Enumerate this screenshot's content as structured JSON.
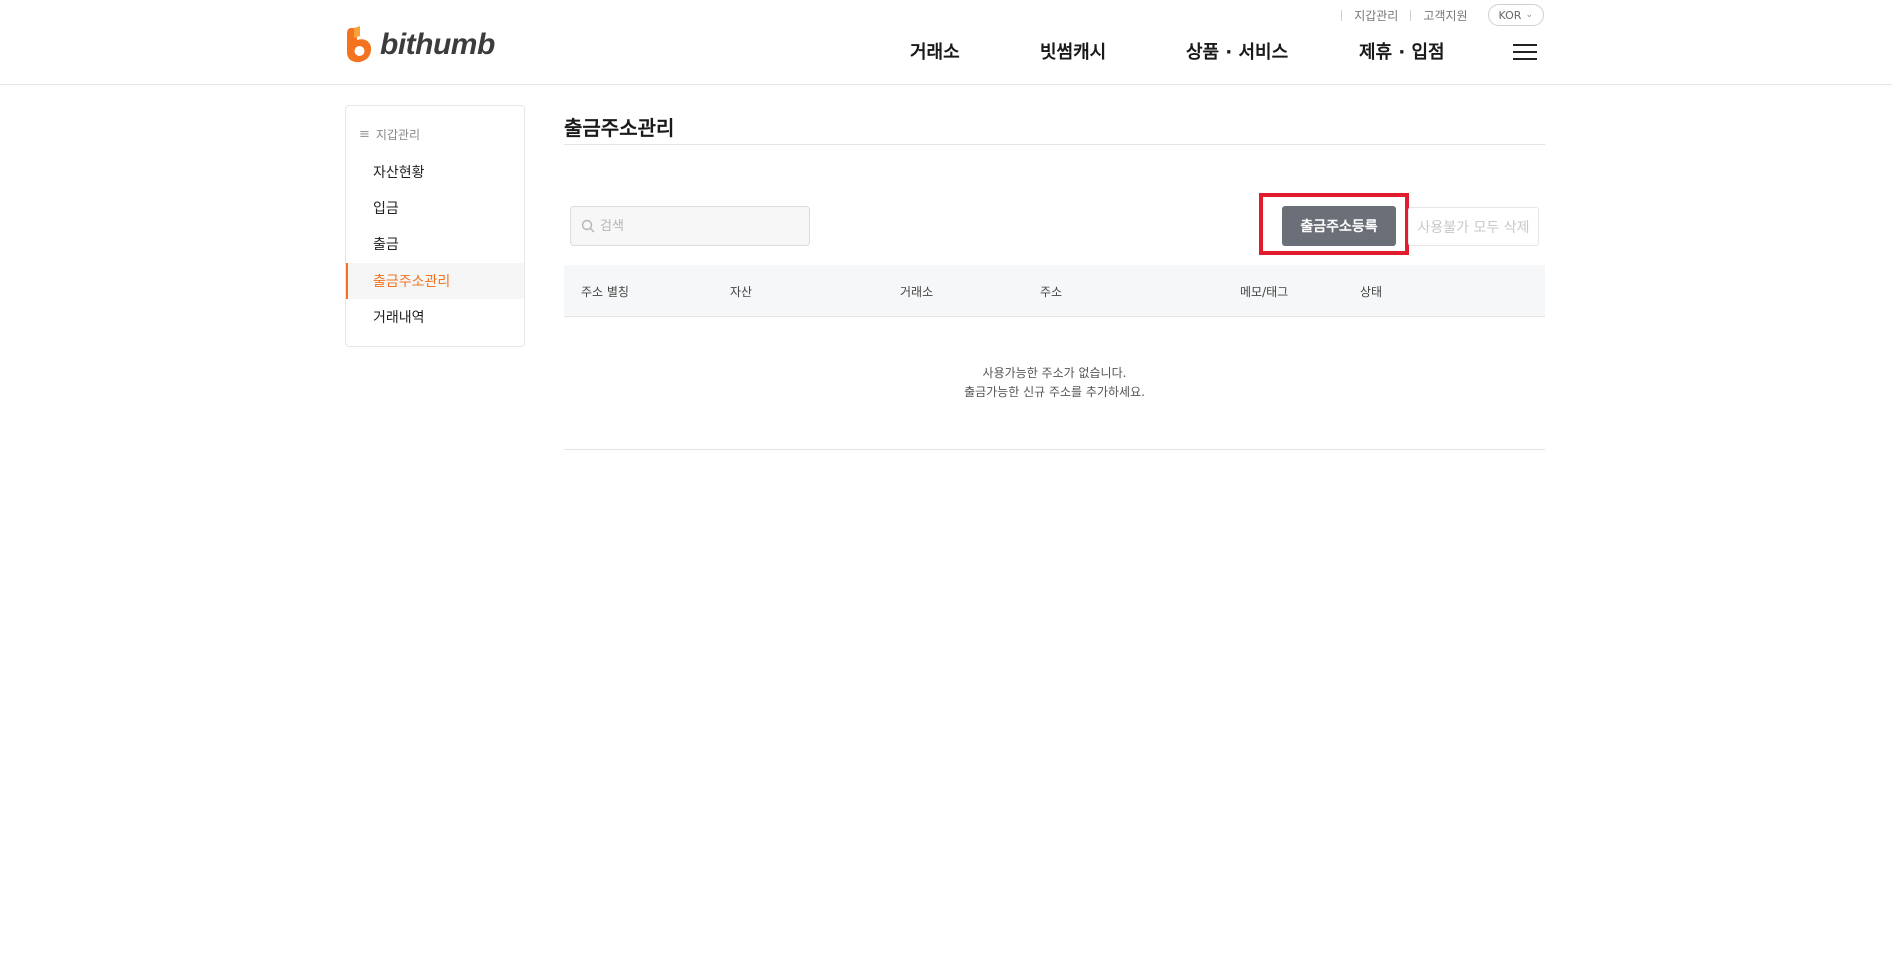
{
  "header": {
    "logo_text": "bithumb",
    "util": {
      "wallet": "지갑관리",
      "support": "고객지원",
      "lang": "KOR"
    },
    "nav": [
      "거래소",
      "빗썸캐시",
      "상품 · 서비스",
      "제휴 · 입점"
    ]
  },
  "sidebar": {
    "title": "지갑관리",
    "items": [
      {
        "label": "자산현황"
      },
      {
        "label": "입금"
      },
      {
        "label": "출금"
      },
      {
        "label": "출금주소관리"
      },
      {
        "label": "거래내역"
      }
    ]
  },
  "main": {
    "title": "출금주소관리",
    "search": {
      "placeholder": "검색",
      "value": ""
    },
    "register_button": "출금주소등록",
    "delete_button": "사용불가 모두 삭제",
    "table": {
      "columns": [
        "주소 별칭",
        "자산",
        "거래소",
        "주소",
        "메모/태그",
        "상태"
      ]
    },
    "empty_line1": "사용가능한 주소가 없습니다.",
    "empty_line2": "출금가능한 신규 주소를 추가하세요."
  },
  "colors": {
    "brand": "#f37321",
    "highlight": "#e01c2d",
    "button": "#6b7078"
  }
}
